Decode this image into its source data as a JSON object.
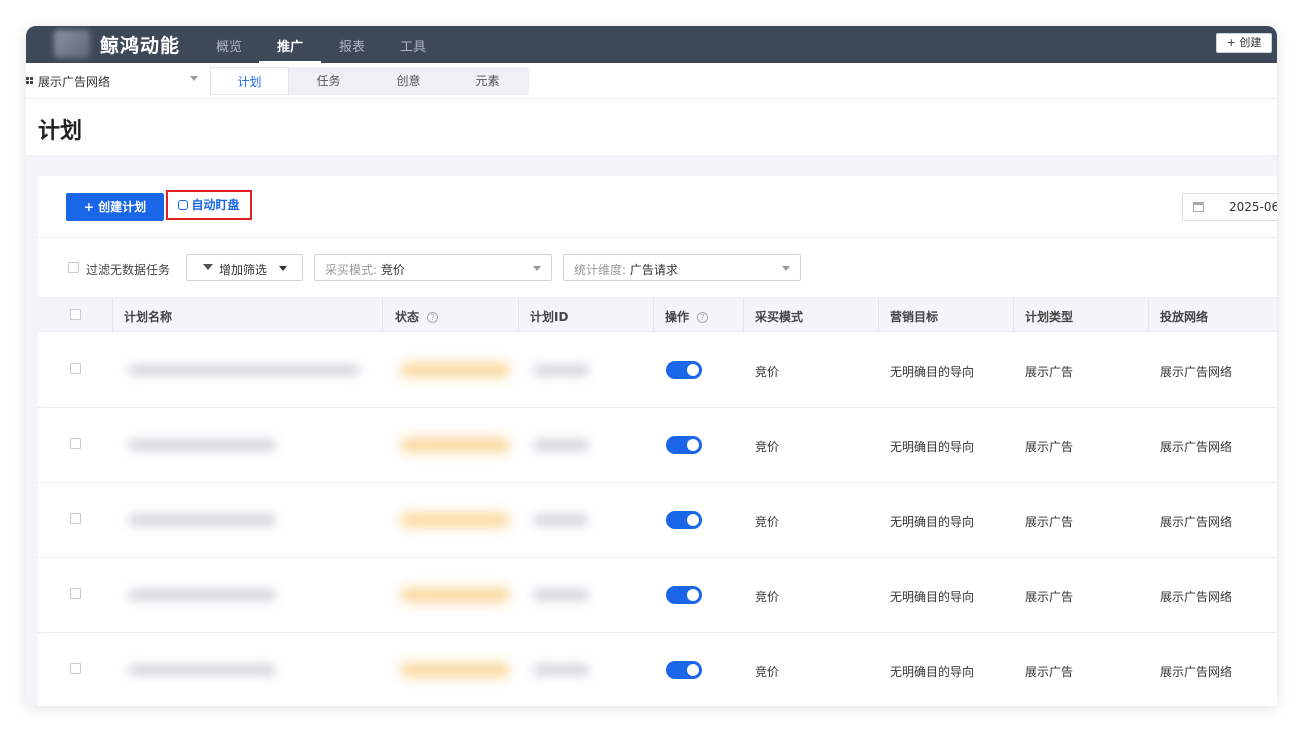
{
  "topbar": {
    "brand": "鲸鸿动能",
    "nav": [
      "概览",
      "推广",
      "报表",
      "工具"
    ],
    "active_nav": "推广",
    "create_button": "+ 创建"
  },
  "subnav": {
    "network_select": "展示广告网络",
    "tabs": [
      "计划",
      "任务",
      "创意",
      "元素"
    ],
    "active_tab": "计划"
  },
  "page": {
    "title": "计划"
  },
  "toolbar": {
    "create_plan": "+ 创建计划",
    "auto_monitor": "自动盯盘",
    "date_value": "2025-06-"
  },
  "filters": {
    "hide_empty_label": "过滤无数据任务",
    "add_filter": "增加筛选",
    "purchase_mode_label": "采买模式:",
    "purchase_mode_value": "竞价",
    "dimension_label": "统计维度:",
    "dimension_value": "广告请求"
  },
  "table": {
    "columns": [
      "计划名称",
      "状态",
      "计划ID",
      "操作",
      "采买模式",
      "营销目标",
      "计划类型",
      "投放网络"
    ],
    "rows": [
      {
        "purchase_mode": "竞价",
        "goal": "无明确目的导向",
        "plan_type": "展示广告",
        "network": "展示广告网络",
        "enabled": true
      },
      {
        "purchase_mode": "竞价",
        "goal": "无明确目的导向",
        "plan_type": "展示广告",
        "network": "展示广告网络",
        "enabled": true
      },
      {
        "purchase_mode": "竞价",
        "goal": "无明确目的导向",
        "plan_type": "展示广告",
        "network": "展示广告网络",
        "enabled": true
      },
      {
        "purchase_mode": "竞价",
        "goal": "无明确目的导向",
        "plan_type": "展示广告",
        "network": "展示广告网络",
        "enabled": true
      },
      {
        "purchase_mode": "竞价",
        "goal": "无明确目的导向",
        "plan_type": "展示广告",
        "network": "展示广告网络",
        "enabled": true
      }
    ]
  },
  "colors": {
    "primary": "#1a66e8",
    "topbar": "#3d4858",
    "highlight_border": "#e0201f"
  }
}
